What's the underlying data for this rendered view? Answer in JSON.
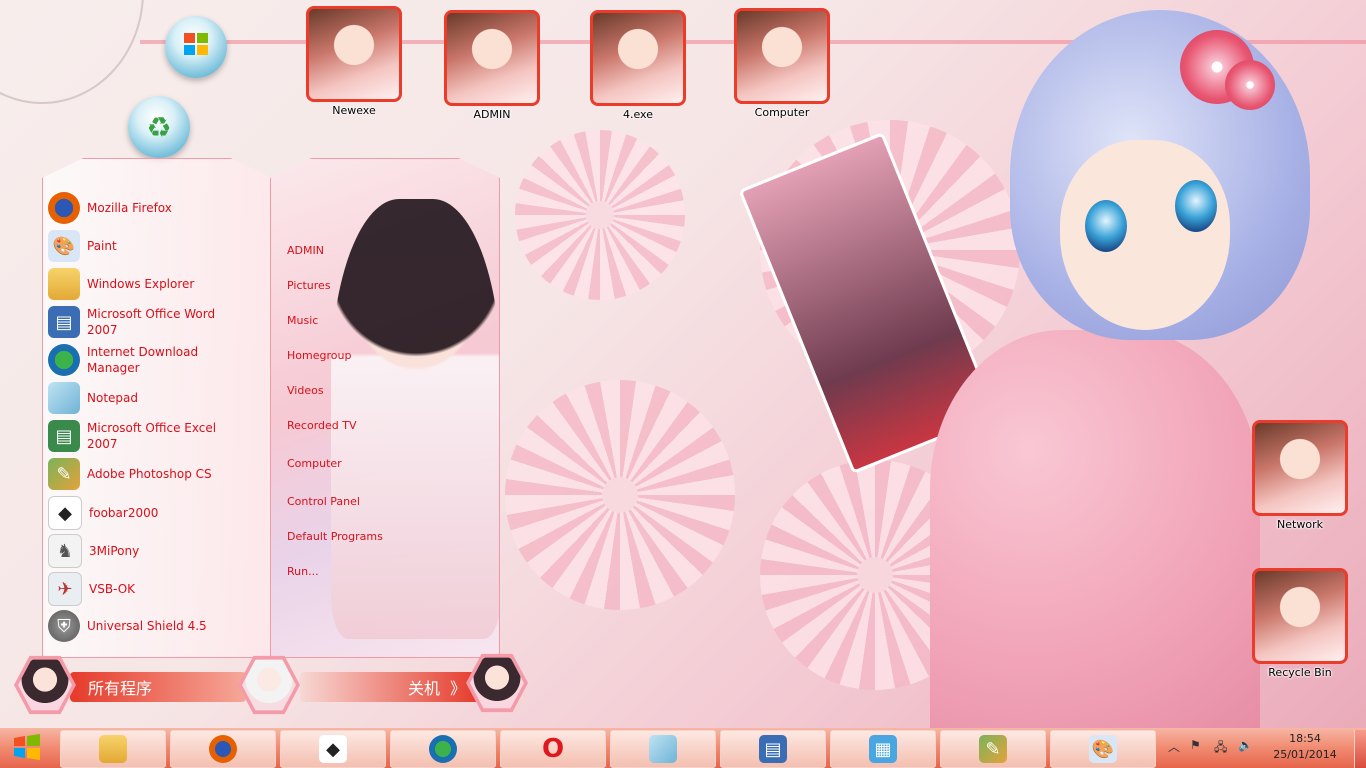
{
  "desktop": {
    "icons": [
      {
        "label": "Newexe"
      },
      {
        "label": "ADMIN"
      },
      {
        "label": "4.exe"
      },
      {
        "label": "Computer"
      },
      {
        "label": "Network"
      },
      {
        "label": "Recycle Bin"
      }
    ]
  },
  "start_menu": {
    "programs": [
      {
        "label": "Mozilla Firefox",
        "icon": "firefox-icon"
      },
      {
        "label": "Paint",
        "icon": "paint-icon"
      },
      {
        "label": "Windows Explorer",
        "icon": "explorer-icon"
      },
      {
        "label": "Microsoft Office Word 2007",
        "icon": "word-icon"
      },
      {
        "label": "Internet Download Manager",
        "icon": "idm-icon"
      },
      {
        "label": "Notepad",
        "icon": "notepad-icon"
      },
      {
        "label": "Microsoft Office Excel 2007",
        "icon": "excel-icon"
      },
      {
        "label": "Adobe Photoshop CS",
        "icon": "photoshop-icon"
      },
      {
        "label": "foobar2000",
        "icon": "foobar-icon"
      },
      {
        "label": "3MiPony",
        "icon": "pony-icon"
      },
      {
        "label": "VSB-OK",
        "icon": "vsb-icon"
      },
      {
        "label": "Universal Shield 4.5",
        "icon": "shield-icon"
      }
    ],
    "places": [
      {
        "label": "ADMIN"
      },
      {
        "label": "Pictures"
      },
      {
        "label": "Music"
      },
      {
        "label": "Homegroup"
      },
      {
        "label": "Videos"
      },
      {
        "label": "Recorded TV"
      },
      {
        "label": "Computer"
      },
      {
        "label": "Control Panel"
      },
      {
        "label": "Default Programs"
      },
      {
        "label": "Run..."
      }
    ],
    "all_programs_label": "所有程序",
    "shutdown_label": "关机",
    "shutdown_arrow": "》"
  },
  "taskbar": {
    "pinned": [
      {
        "icon": "explorer-icon"
      },
      {
        "icon": "firefox-icon"
      },
      {
        "icon": "foobar-icon"
      },
      {
        "icon": "idm-icon"
      },
      {
        "icon": "opera-icon"
      },
      {
        "icon": "notepad-icon"
      },
      {
        "icon": "word-icon"
      },
      {
        "icon": "control-panel-icon"
      },
      {
        "icon": "photoshop-icon"
      },
      {
        "icon": "paint-icon"
      }
    ],
    "clock": {
      "time": "18:54",
      "date": "25/01/2014"
    }
  },
  "colors": {
    "accent": "#ea3b2b",
    "menu_text": "#d8101a",
    "taskbar": "#f08a70"
  }
}
